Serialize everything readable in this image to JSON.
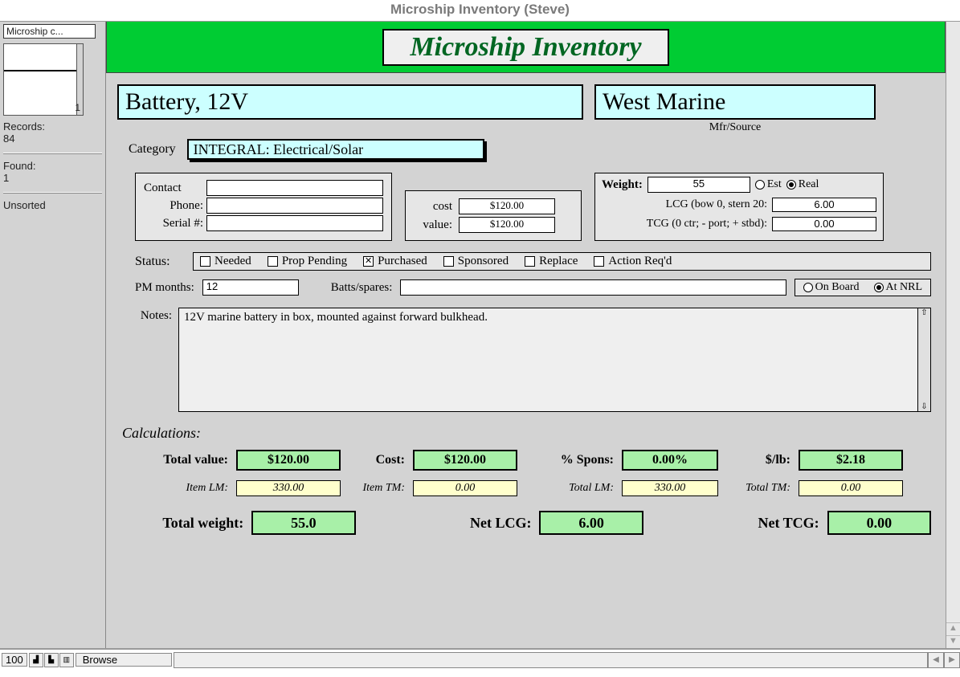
{
  "window_title": "Microship Inventory (Steve)",
  "sidepanel": {
    "layout_name": "Microship c...",
    "record_index": "1",
    "records_label": "Records:",
    "records_count": "84",
    "found_label": "Found:",
    "found_count": "1",
    "sort_state": "Unsorted"
  },
  "banner": "Microship Inventory",
  "item": {
    "name": "Battery, 12V",
    "mfr": "West Marine",
    "mfr_label": "Mfr/Source",
    "category_label": "Category",
    "category": "INTEGRAL: Electrical/Solar"
  },
  "contact": {
    "contact_label": "Contact",
    "contact": "",
    "phone_label": "Phone:",
    "phone": "",
    "serial_label": "Serial #:",
    "serial": ""
  },
  "cost": {
    "cost_label": "cost",
    "cost": "$120.00",
    "value_label": "value:",
    "value": "$120.00"
  },
  "weight": {
    "label": "Weight:",
    "value": "55",
    "est_label": "Est",
    "real_label": "Real",
    "est_checked": false,
    "real_checked": true,
    "lcg_label": "LCG (bow 0, stern 20:",
    "lcg": "6.00",
    "tcg_label": "TCG (0 ctr; - port; + stbd):",
    "tcg": "0.00"
  },
  "status": {
    "label": "Status:",
    "options": [
      {
        "label": "Needed",
        "checked": false
      },
      {
        "label": "Prop Pending",
        "checked": false
      },
      {
        "label": "Purchased",
        "checked": true
      },
      {
        "label": "Sponsored",
        "checked": false
      },
      {
        "label": "Replace",
        "checked": false
      },
      {
        "label": "Action Req'd",
        "checked": false
      }
    ]
  },
  "pm": {
    "label": "PM months:",
    "value": "12",
    "batts_label": "Batts/spares:",
    "batts": "",
    "onboard_label": "On Board",
    "atnrl_label": "At NRL",
    "onboard_checked": false,
    "atnrl_checked": true
  },
  "notes": {
    "label": "Notes:",
    "text": "12V marine battery in box, mounted against forward bulkhead."
  },
  "calc": {
    "heading": "Calculations:",
    "total_value_label": "Total value:",
    "total_value": "$120.00",
    "cost_label": "Cost:",
    "cost": "$120.00",
    "spons_label": "% Spons:",
    "spons": "0.00%",
    "perlb_label": "$/lb:",
    "perlb": "$2.18",
    "item_lm_label": "Item LM:",
    "item_lm": "330.00",
    "item_tm_label": "Item TM:",
    "item_tm": "0.00",
    "total_lm_label": "Total LM:",
    "total_lm": "330.00",
    "total_tm_label": "Total TM:",
    "total_tm": "0.00",
    "total_weight_label": "Total weight:",
    "total_weight": "55.0",
    "net_lcg_label": "Net LCG:",
    "net_lcg": "6.00",
    "net_tcg_label": "Net TCG:",
    "net_tcg": "0.00"
  },
  "footer": {
    "zoom": "100",
    "mode": "Browse"
  }
}
